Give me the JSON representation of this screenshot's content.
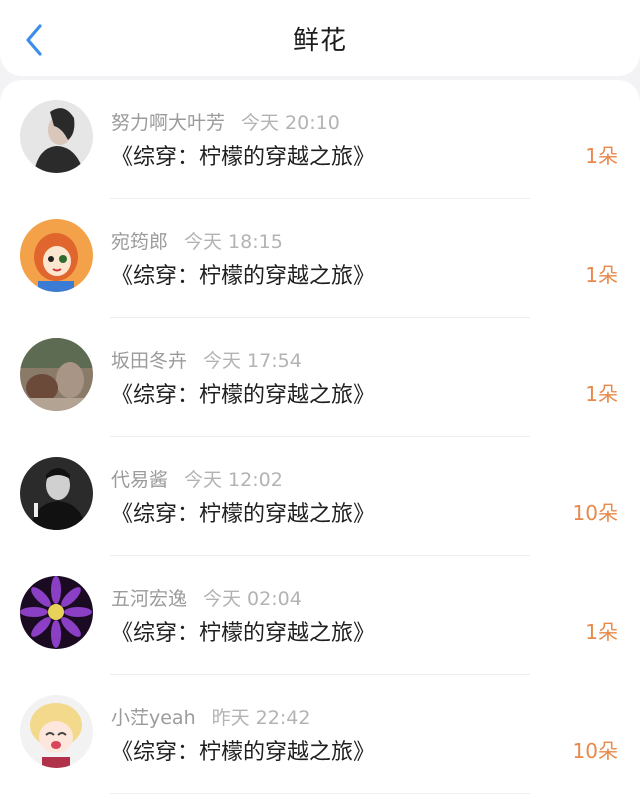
{
  "header": {
    "title": "鲜花",
    "back_icon": "chevron-left-icon",
    "accent_color": "#3b8fe8"
  },
  "list": {
    "count_color": "#e8884a",
    "items": [
      {
        "user": "努力啊大叶芳",
        "time": "今天 20:10",
        "book": "《综穿：柠檬的穿越之旅》",
        "count": "1朵",
        "avatar": "woman-portrait"
      },
      {
        "user": "宛筠郎",
        "time": "今天 18:15",
        "book": "《综穿：柠檬的穿越之旅》",
        "count": "1朵",
        "avatar": "cartoon-girl-orange"
      },
      {
        "user": "坂田冬卉",
        "time": "今天 17:54",
        "book": "《综穿：柠檬的穿越之旅》",
        "count": "1朵",
        "avatar": "blurred-photo"
      },
      {
        "user": "代易酱",
        "time": "今天 12:02",
        "book": "《综穿：柠檬的穿越之旅》",
        "count": "10朵",
        "avatar": "man-bw-portrait"
      },
      {
        "user": "五河宏逸",
        "time": "今天 02:04",
        "book": "《综穿：柠檬的穿越之旅》",
        "count": "1朵",
        "avatar": "purple-flower"
      },
      {
        "user": "小茳yeah",
        "time": "昨天 22:42",
        "book": "《综穿：柠檬的穿越之旅》",
        "count": "10朵",
        "avatar": "anime-girl-crying"
      }
    ]
  }
}
